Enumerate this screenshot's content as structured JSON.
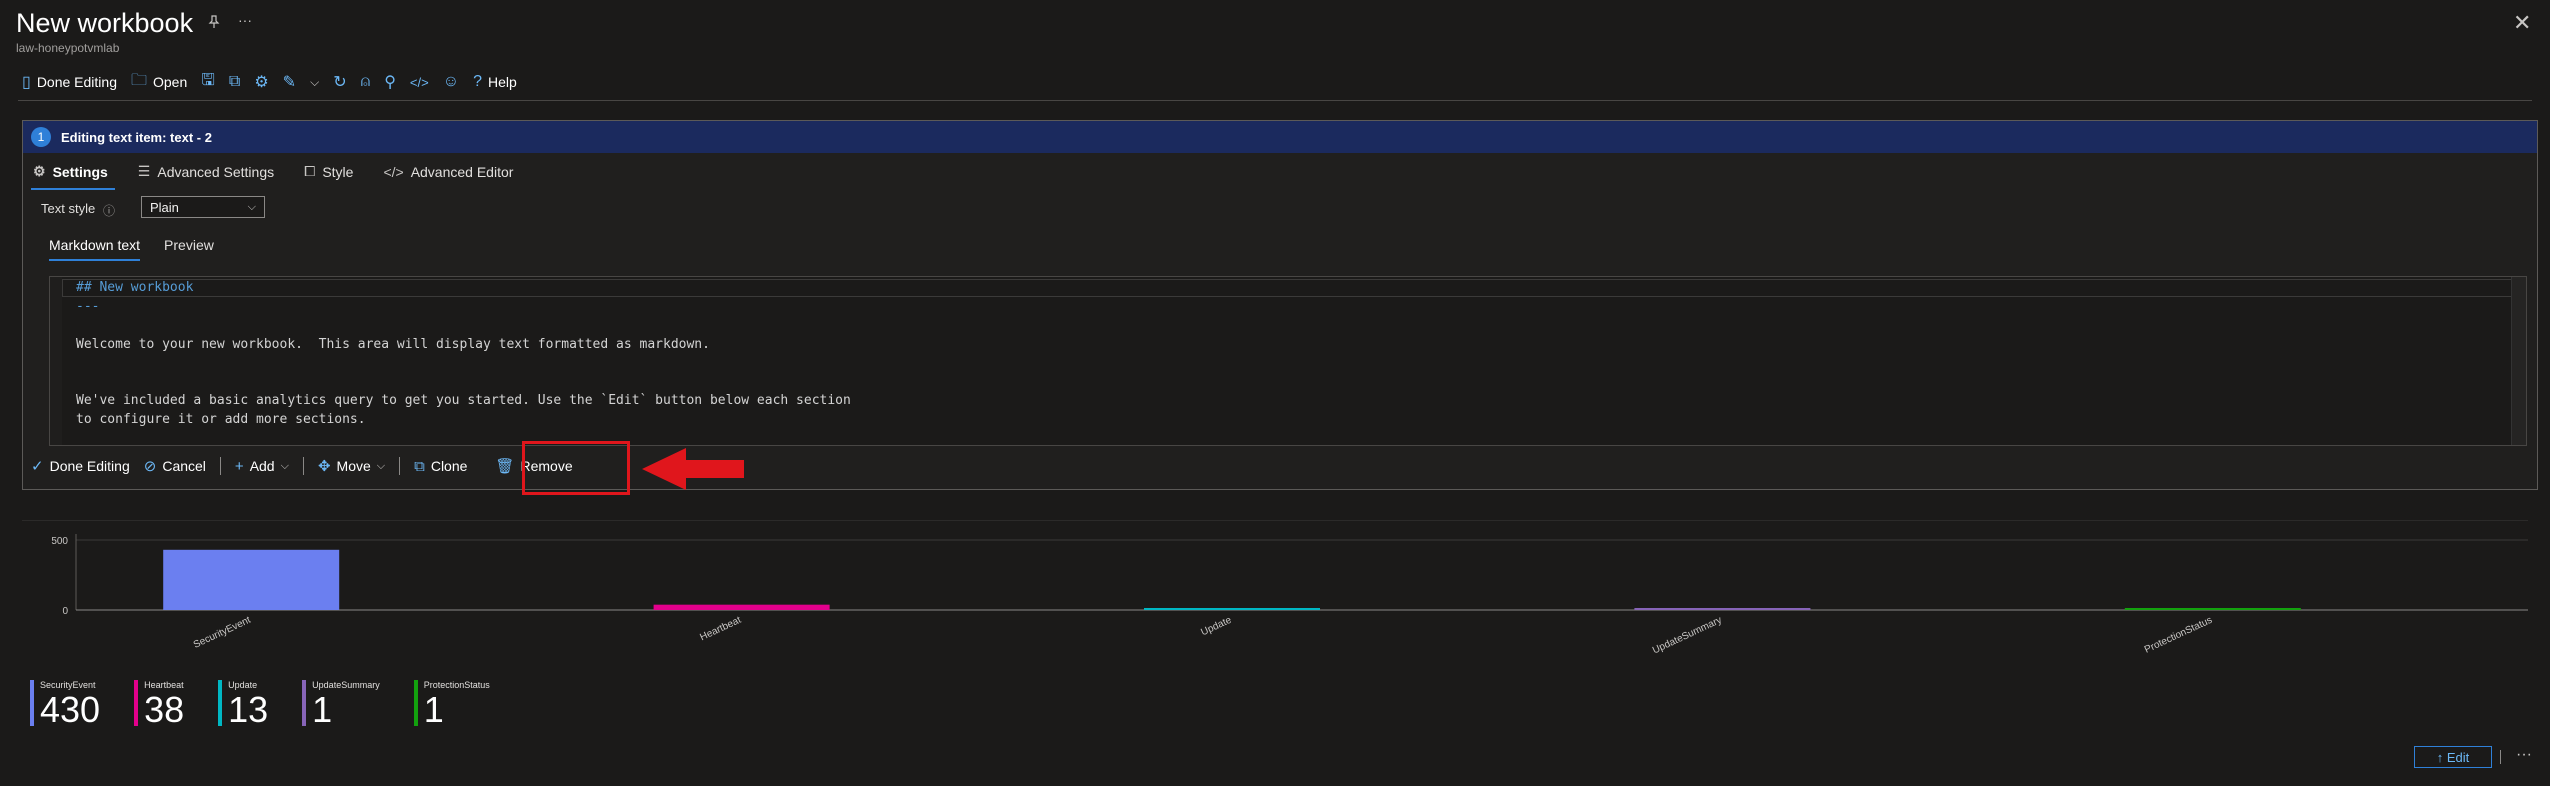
{
  "header": {
    "title": "New workbook",
    "subtitle": "law-honeypotvmlab",
    "pin_icon": "pin-icon",
    "more_label": "···",
    "close_label": "✕"
  },
  "toolbar": {
    "done_editing": "Done Editing",
    "open": "Open",
    "help": "Help",
    "icons": [
      "done-editing-icon",
      "open-icon",
      "save-icon",
      "save-as-icon",
      "settings-icon",
      "edit-icon",
      "chevron-down-icon",
      "refresh-icon",
      "alerts-icon",
      "pin-icon",
      "advanced-editor-icon",
      "feedback-icon",
      "help-icon"
    ]
  },
  "editing": {
    "step_number": "1",
    "header": "Editing text item: text - 2",
    "tabs": [
      {
        "label": "Settings",
        "icon": "settings-icon"
      },
      {
        "label": "Advanced Settings",
        "icon": "sliders-icon"
      },
      {
        "label": "Style",
        "icon": "style-icon"
      },
      {
        "label": "Advanced Editor",
        "icon": "code-icon"
      }
    ],
    "text_style_label": "Text style",
    "text_style_value": "Plain",
    "subtabs": [
      "Markdown text",
      "Preview"
    ],
    "code_lines": [
      "## New workbook",
      "---",
      "Welcome to your new workbook.  This area will display text formatted as markdown.",
      "We've included a basic analytics query to get you started. Use the `Edit` button below each section",
      "to configure it or add more sections."
    ],
    "actions": {
      "done_editing": "Done Editing",
      "cancel": "Cancel",
      "add": "Add",
      "move": "Move",
      "clone": "Clone",
      "remove": "Remove"
    }
  },
  "colors": {
    "accent": "#2f80d8",
    "annotation_red": "#e0161c",
    "header_bg": "#1b2a5e"
  },
  "chart_data": {
    "type": "bar",
    "categories": [
      "SecurityEvent",
      "Heartbeat",
      "Update",
      "UpdateSummary",
      "ProtectionStatus"
    ],
    "values": [
      430,
      38,
      13,
      1,
      1
    ],
    "colors": [
      "#6b7ff0",
      "#e3008c",
      "#00b7c3",
      "#8764b8",
      "#13a10e"
    ],
    "yticks": [
      0,
      500
    ],
    "ylim": [
      0,
      500
    ]
  },
  "footer": {
    "edit_label": "↑ Edit",
    "more_label": "···"
  }
}
